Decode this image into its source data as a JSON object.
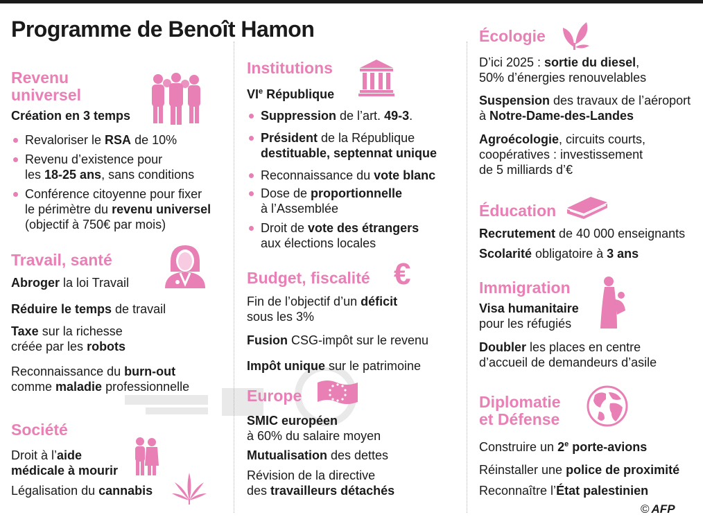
{
  "title": "Programme de Benoît Hamon",
  "colors": {
    "accent": "#e87fb5",
    "text": "#1a1a1a"
  },
  "revenu": {
    "heading_l1": "Revenu",
    "heading_l2": "universel",
    "icon": "group-of-people-icon",
    "sub": "Création en 3 temps",
    "b1_pre": "Revaloriser le ",
    "b1_b": "RSA",
    "b1_post": " de 10%",
    "b2_l1": "Revenu d’existence pour",
    "b2_l2_pre": "les ",
    "b2_l2_b": "18-25 ans",
    "b2_l2_post": ", sans conditions",
    "b3_l1": "Conférence citoyenne pour fixer",
    "b3_l2_pre": "le périmètre du ",
    "b3_l2_b": "revenu universel",
    "b3_l3": "(objectif à 750€ par mois)"
  },
  "travail": {
    "heading": "Travail, santé",
    "icon": "doctor-icon",
    "i1_b": "Abroger",
    "i1_post": " la loi Travail",
    "i2_b": "Réduire le temps",
    "i2_post": " de travail",
    "i3_b": "Taxe",
    "i3_post": " sur la richesse",
    "i3_l2_pre": "créée par les ",
    "i3_l2_b": "robots",
    "i4_pre": "Reconnaissance du ",
    "i4_b": "burn-out",
    "i4_l2_pre": "comme ",
    "i4_l2_b": "maladie",
    "i4_l2_post": " professionnelle"
  },
  "societe": {
    "heading": "Société",
    "icon": "elderly-couple-icon",
    "icon2": "cannabis-leaf-icon",
    "i1_pre": "Droit à l’",
    "i1_b": "aide",
    "i1_l2_b": "médicale à mourir",
    "i2_pre": "Légalisation du ",
    "i2_b": "cannabis"
  },
  "institutions": {
    "heading": "Institutions",
    "icon": "institution-building-icon",
    "sub_pre": "VI",
    "sub_sup": "e",
    "sub_post": " République",
    "b1_b": "Suppression",
    "b1_mid": " de l’art. ",
    "b1_b2": "49-3",
    "b1_post": ".",
    "b2_b": "Président",
    "b2_post": " de la République",
    "b2_l2_b": "destituable, septennat unique",
    "b3_pre": "Reconnaissance du ",
    "b3_b": "vote blanc",
    "b4_pre": "Dose de ",
    "b4_b": "proportionnelle",
    "b4_l2": "à l’Assemblée",
    "b5_pre": "Droit de ",
    "b5_b": "vote des étrangers",
    "b5_l2": "aux élections locales"
  },
  "budget": {
    "heading": "Budget, fiscalité",
    "icon": "euro-icon",
    "euro_glyph": "€",
    "i1_pre": "Fin de l’objectif d’un ",
    "i1_b": "déficit",
    "i1_l2": "sous les 3%",
    "i2_b": "Fusion",
    "i2_post": " CSG-impôt sur le revenu",
    "i3_b": "Impôt unique",
    "i3_post": " sur le patrimoine"
  },
  "europe": {
    "heading": "Europe",
    "icon": "eu-flag-icon",
    "i1_b": "SMIC européen",
    "i1_l2": "à 60% du salaire moyen",
    "i2_b": "Mutualisation",
    "i2_post": " des dettes",
    "i3_l1": "Révision de la directive",
    "i3_l2_pre": "des ",
    "i3_l2_b": "travailleurs détachés"
  },
  "ecologie": {
    "heading": "Écologie",
    "icon": "leaves-icon",
    "i1_pre": "D’ici 2025 : ",
    "i1_b": "sortie du diesel",
    "i1_post": ",",
    "i1_l2": "50% d’énergies renouvelables",
    "i2_b": "Suspension",
    "i2_post": " des travaux de l’aéroport",
    "i2_l2_pre": "à ",
    "i2_l2_b": "Notre-Dame-des-Landes",
    "i3_b": "Agroécologie",
    "i3_post": ", circuits courts,",
    "i3_l2": "coopératives : investissement",
    "i3_l3": "de 5 milliards d’€"
  },
  "education": {
    "heading": "Éducation",
    "icon": "book-icon",
    "i1_b": "Recrutement",
    "i1_post": " de 40 000 enseignants",
    "i2_b": "Scolarité",
    "i2_mid": " obligatoire à ",
    "i2_b2": "3 ans"
  },
  "immigration": {
    "heading": "Immigration",
    "icon": "refugee-icon",
    "i1_b": "Visa humanitaire",
    "i1_l2": "pour les réfugiés",
    "i2_b": "Doubler",
    "i2_post": " les places en centre",
    "i2_l2": "d’accueil de demandeurs d’asile"
  },
  "diplomatie": {
    "heading_l1": "Diplomatie",
    "heading_l2": "et Défense",
    "icon": "globe-icon",
    "i1_pre": "Construire un ",
    "i1_b": "2",
    "i1_sup": "e",
    "i1_b2": " porte-avions",
    "i2_pre": "Réinstaller une ",
    "i2_b": "police de proximité",
    "i3_pre": "Reconnaître l’",
    "i3_b": "État palestinien"
  },
  "credit": {
    "copyright": "©",
    "agency": "AFP"
  }
}
